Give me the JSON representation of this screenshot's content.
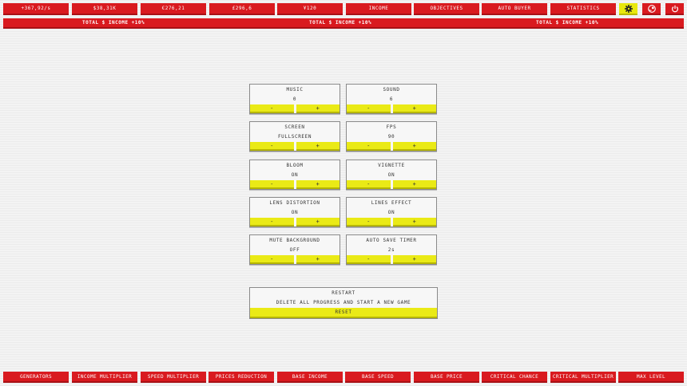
{
  "topbar": {
    "income_rate": "+367,92/s",
    "currencies": [
      "$38,31K",
      "€276,21",
      "£296,6",
      "¥120"
    ],
    "tabs": [
      "INCOME",
      "OBJECTIVES",
      "AUTO BUYER",
      "STATISTICS"
    ],
    "icons": [
      "gear-icon",
      "steam-icon",
      "power-icon"
    ],
    "active_icon": "gear-icon",
    "colors": {
      "bar": "#d91a1f",
      "active": "#e8e80c"
    }
  },
  "ticker": {
    "messages": [
      "TOTAL $ INCOME +10%",
      "TOTAL $ INCOME +10%",
      "TOTAL $ INCOME +10%"
    ]
  },
  "settings": [
    {
      "label": "MUSIC",
      "value": "0",
      "minus": "-",
      "plus": "+"
    },
    {
      "label": "SOUND",
      "value": "6",
      "minus": "-",
      "plus": "+"
    },
    {
      "label": "SCREEN",
      "value": "FULLSCREEN",
      "minus": "-",
      "plus": "+"
    },
    {
      "label": "FPS",
      "value": "90",
      "minus": "-",
      "plus": "+"
    },
    {
      "label": "BLOOM",
      "value": "ON",
      "minus": "-",
      "plus": "+"
    },
    {
      "label": "VIGNETTE",
      "value": "ON",
      "minus": "-",
      "plus": "+"
    },
    {
      "label": "LENS DISTORTION",
      "value": "ON",
      "minus": "-",
      "plus": "+"
    },
    {
      "label": "LINES EFFECT",
      "value": "ON",
      "minus": "-",
      "plus": "+"
    },
    {
      "label": "MUTE BACKGROUND",
      "value": "OFF",
      "minus": "-",
      "plus": "+"
    },
    {
      "label": "AUTO SAVE TIMER",
      "value": "2s",
      "minus": "-",
      "plus": "+"
    }
  ],
  "restart": {
    "title": "RESTART",
    "description": "DELETE ALL PROGRESS AND START A NEW GAME",
    "button": "RESET"
  },
  "bottombar": {
    "tabs": [
      "GENERATORS",
      "INCOME MULTIPLIER",
      "SPEED MULTIPLIER",
      "PRICES REDUCTION",
      "BASE INCOME",
      "BASE SPEED",
      "BASE PRICE",
      "CRITICAL CHANCE",
      "CRITICAL MULTIPLIER",
      "MAX LEVEL"
    ]
  }
}
